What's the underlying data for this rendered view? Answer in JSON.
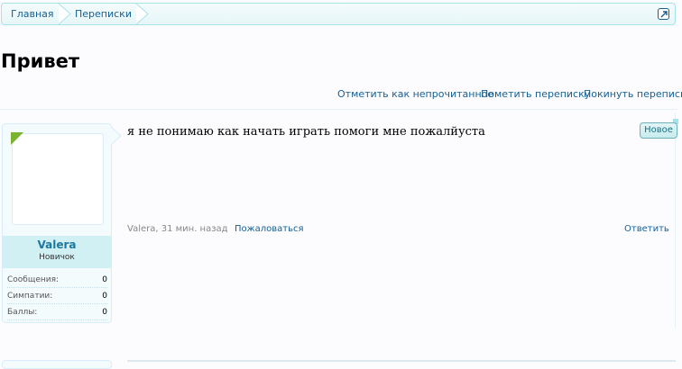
{
  "breadcrumb": {
    "items": [
      {
        "label": "Главная"
      },
      {
        "label": "Переписки"
      }
    ]
  },
  "page": {
    "title": "Привет"
  },
  "controls": {
    "mark_unread": "Отметить как непрочитанное",
    "star": "Пометить переписку",
    "leave": "Покинуть переписку"
  },
  "message": {
    "text": "я не понимаю как начать играть помоги мне пожалйуста",
    "badge_new": "Новое",
    "meta_author_time": "Valera, 31 мин. назад",
    "report_label": "Пожаловаться",
    "reply_label": "Ответить"
  },
  "user": {
    "name": "Valera",
    "title": "Новичок",
    "stats": [
      {
        "label": "Сообщения:",
        "value": "0"
      },
      {
        "label": "Симпатии:",
        "value": "0"
      },
      {
        "label": "Баллы:",
        "value": "0"
      }
    ]
  },
  "colors": {
    "link": "#176093",
    "accent_border": "#a5e3e9",
    "online_flag": "#7bb32e"
  },
  "icons": {
    "jump": "jump-to-top-icon",
    "online": "online-indicator-icon"
  }
}
